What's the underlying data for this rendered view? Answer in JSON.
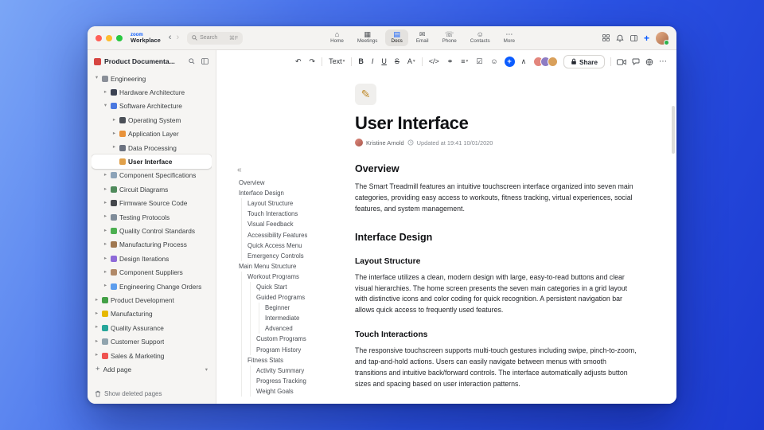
{
  "titlebar": {
    "logo_line1": "zoom",
    "logo_line2": "Workplace",
    "search": {
      "placeholder": "Search",
      "shortcut": "⌘F"
    },
    "tabs": [
      {
        "label": "Home",
        "glyph": "⌂",
        "active": false
      },
      {
        "label": "Meetings",
        "glyph": "▦",
        "active": false
      },
      {
        "label": "Docs",
        "glyph": "▤",
        "active": true
      },
      {
        "label": "Email",
        "glyph": "✉",
        "active": false
      },
      {
        "label": "Phone",
        "glyph": "☏",
        "active": false
      },
      {
        "label": "Contacts",
        "glyph": "☺",
        "active": false
      },
      {
        "label": "More",
        "glyph": "⋯",
        "active": false
      }
    ]
  },
  "sidebar": {
    "workspace_label": "Product Documenta...",
    "tree": [
      {
        "label": "Engineering",
        "depth": 0,
        "chevron": "expanded",
        "icon_color": "#8a8f98"
      },
      {
        "label": "Hardware Architecture",
        "depth": 1,
        "chevron": "collapsed",
        "icon_color": "#3b4252"
      },
      {
        "label": "Software Architecture",
        "depth": 1,
        "chevron": "expanded",
        "icon_color": "#4a78e0"
      },
      {
        "label": "Operating System",
        "depth": 2,
        "chevron": "collapsed",
        "icon_color": "#4a4f57"
      },
      {
        "label": "Application Layer",
        "depth": 2,
        "chevron": "collapsed",
        "icon_color": "#e8923a"
      },
      {
        "label": "Data Processing",
        "depth": 2,
        "chevron": "collapsed",
        "icon_color": "#6b7280"
      },
      {
        "label": "User Interface",
        "depth": 2,
        "chevron": "none",
        "icon_color": "#e0a04a",
        "selected": true
      },
      {
        "label": "Component Specifications",
        "depth": 1,
        "chevron": "collapsed",
        "icon_color": "#8ca3b8"
      },
      {
        "label": "Circuit Diagrams",
        "depth": 1,
        "chevron": "collapsed",
        "icon_color": "#4f8a5b"
      },
      {
        "label": "Firmware Source Code",
        "depth": 1,
        "chevron": "collapsed",
        "icon_color": "#44474c"
      },
      {
        "label": "Testing Protocols",
        "depth": 1,
        "chevron": "collapsed",
        "icon_color": "#7f8c99"
      },
      {
        "label": "Quality Control Standards",
        "depth": 1,
        "chevron": "collapsed",
        "icon_color": "#4caf50"
      },
      {
        "label": "Manufacturing Process",
        "depth": 1,
        "chevron": "collapsed",
        "icon_color": "#a07850"
      },
      {
        "label": "Design Iterations",
        "depth": 1,
        "chevron": "collapsed",
        "icon_color": "#8e6ad8"
      },
      {
        "label": "Component Suppliers",
        "depth": 1,
        "chevron": "collapsed",
        "icon_color": "#b08968"
      },
      {
        "label": "Engineering Change Orders",
        "depth": 1,
        "chevron": "collapsed",
        "icon_color": "#5c9ded"
      },
      {
        "label": "Product Development",
        "depth": 0,
        "chevron": "collapsed",
        "icon_color": "#43a047"
      },
      {
        "label": "Manufacturing",
        "depth": 0,
        "chevron": "collapsed",
        "icon_color": "#e6b800"
      },
      {
        "label": "Quality Assurance",
        "depth": 0,
        "chevron": "collapsed",
        "icon_color": "#26a69a"
      },
      {
        "label": "Customer Support",
        "depth": 0,
        "chevron": "collapsed",
        "icon_color": "#90a4ae"
      },
      {
        "label": "Sales & Marketing",
        "depth": 0,
        "chevron": "collapsed",
        "icon_color": "#ef5350"
      }
    ],
    "add_page_label": "Add page",
    "show_deleted_label": "Show deleted pages"
  },
  "outline": {
    "items": [
      {
        "label": "Overview",
        "depth": 0
      },
      {
        "label": "Interface Design",
        "depth": 0
      },
      {
        "label": "Layout Structure",
        "depth": 1
      },
      {
        "label": "Touch Interactions",
        "depth": 1
      },
      {
        "label": "Visual Feedback",
        "depth": 1
      },
      {
        "label": "Accessibility Features",
        "depth": 1
      },
      {
        "label": "Quick Access Menu",
        "depth": 1
      },
      {
        "label": "Emergency Controls",
        "depth": 1
      },
      {
        "label": "Main Menu Structure",
        "depth": 0
      },
      {
        "label": "Workout Programs",
        "depth": 1
      },
      {
        "label": "Quick Start",
        "depth": 2
      },
      {
        "label": "Guided Programs",
        "depth": 2
      },
      {
        "label": "Beginner",
        "depth": 3
      },
      {
        "label": "Intermediate",
        "depth": 3
      },
      {
        "label": "Advanced",
        "depth": 3
      },
      {
        "label": "Custom Programs",
        "depth": 2
      },
      {
        "label": "Program History",
        "depth": 2
      },
      {
        "label": "Fitness Stats",
        "depth": 1
      },
      {
        "label": "Activity Summary",
        "depth": 2
      },
      {
        "label": "Progress Tracking",
        "depth": 2
      },
      {
        "label": "Weight Goals",
        "depth": 2
      }
    ]
  },
  "toolbar": {
    "items": [
      {
        "name": "undo",
        "glyph": "↶"
      },
      {
        "name": "redo",
        "glyph": "↷"
      },
      {
        "type": "divider"
      },
      {
        "name": "text-style",
        "label": "Text",
        "caret": true
      },
      {
        "type": "divider"
      },
      {
        "name": "bold",
        "glyph": "B",
        "cls": "fw"
      },
      {
        "name": "italic",
        "glyph": "I",
        "cls": "it"
      },
      {
        "name": "underline",
        "glyph": "U",
        "cls": "un"
      },
      {
        "name": "strikethrough",
        "glyph": "S",
        "cls": "st"
      },
      {
        "name": "text-color",
        "glyph": "A",
        "caret": true
      },
      {
        "type": "divider"
      },
      {
        "name": "code-block",
        "glyph": "</>"
      },
      {
        "name": "link",
        "glyph": "⚭"
      },
      {
        "name": "bullet-list",
        "glyph": "≡",
        "caret": true
      },
      {
        "name": "checklist",
        "glyph": "☑"
      },
      {
        "name": "emoji",
        "glyph": "☺"
      },
      {
        "name": "insert",
        "glyph": "+",
        "cls": "plus"
      },
      {
        "name": "collapse-toolbar",
        "glyph": "∧"
      }
    ],
    "avatars": [
      "#e3867d",
      "#8e7cc3",
      "#d9a05b"
    ],
    "share_label": "Share"
  },
  "doc": {
    "title": "User Interface",
    "author": "Kristine Arnold",
    "updated": "Updated at 19:41 10/01/2020",
    "sections": [
      {
        "type": "h1",
        "text": "Overview"
      },
      {
        "type": "p",
        "text": "The Smart Treadmill features an intuitive touchscreen interface organized into seven main categories, providing easy access to workouts, fitness tracking, virtual experiences, social features, and system management."
      },
      {
        "type": "h1",
        "text": "Interface Design"
      },
      {
        "type": "h2",
        "text": "Layout Structure"
      },
      {
        "type": "p",
        "text": "The interface utilizes a clean, modern design with large, easy-to-read buttons and clear visual hierarchies. The home screen presents the seven main categories in a grid layout with distinctive icons and color coding for quick recognition. A persistent navigation bar allows quick access to frequently used features."
      },
      {
        "type": "h2",
        "text": "Touch Interactions"
      },
      {
        "type": "p",
        "text": "The responsive touchscreen supports multi-touch gestures including swipe, pinch-to-zoom, and tap-and-hold actions. Users can easily navigate between menus with smooth transitions and intuitive back/forward controls. The interface automatically adjusts button sizes and spacing based on user interaction patterns."
      }
    ]
  }
}
